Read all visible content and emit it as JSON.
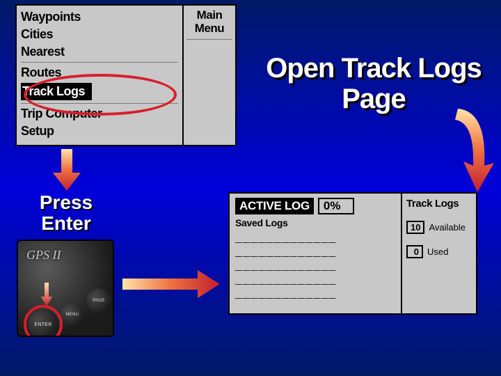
{
  "menu": {
    "title_line1": "Main",
    "title_line2": "Menu",
    "items": [
      {
        "label": "Waypoints"
      },
      {
        "label": "Cities"
      },
      {
        "label": "Nearest"
      },
      {
        "label": "Routes"
      },
      {
        "label": "Track Logs",
        "highlighted": true
      },
      {
        "label": "Trip Computer"
      },
      {
        "label": "Setup"
      }
    ]
  },
  "headline": "Open Track Logs Page",
  "press_enter": "Press Enter",
  "device": {
    "brand": "GPS II",
    "buttons": {
      "enter": "ENTER",
      "menu": "MENU",
      "page": "PAGE"
    }
  },
  "tracklogs": {
    "active_label": "ACTIVE LOG",
    "percent": "0%",
    "saved_label": "Saved Logs",
    "slot": "_____________",
    "slot_count": 5,
    "panel_title": "Track Logs",
    "available_value": "10",
    "available_label": "Available",
    "used_value": "0",
    "used_label": "Used"
  }
}
